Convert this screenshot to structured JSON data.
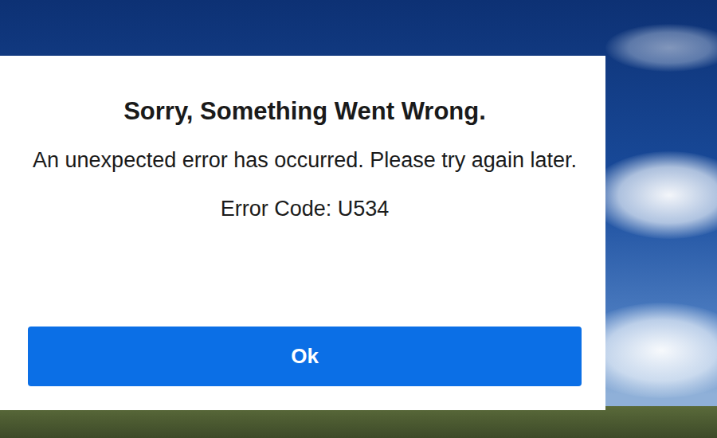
{
  "dialog": {
    "title": "Sorry, Something Went Wrong.",
    "message": "An unexpected error has occurred. Please try again later.",
    "error_code": "Error Code: U534"
  },
  "buttons": [
    "Ok"
  ]
}
